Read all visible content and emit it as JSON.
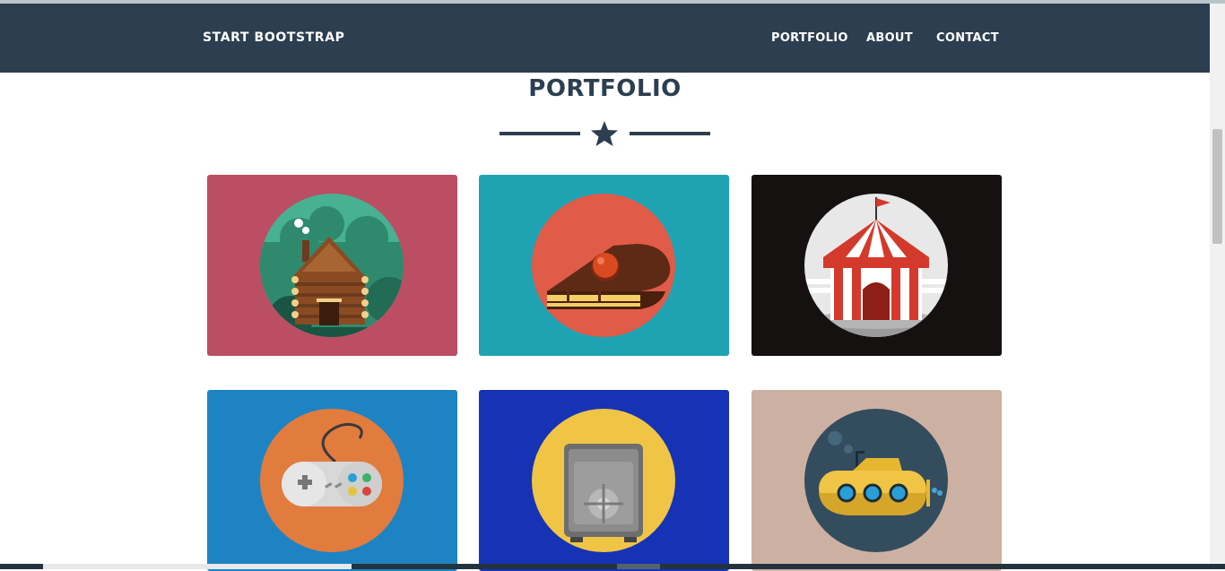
{
  "navbar": {
    "brand": "Start Bootstrap",
    "links": [
      "Portfolio",
      "About",
      "Contact"
    ]
  },
  "section": {
    "title": "Portfolio"
  },
  "portfolio_items": [
    {
      "icon": "cabin-icon",
      "background": "#bb4e63",
      "circle": "#47b192"
    },
    {
      "icon": "cake-icon",
      "background": "#1fa3b2",
      "circle": "#e05b48"
    },
    {
      "icon": "circus-tent-icon",
      "background": "#141110",
      "circle": "#e8e8e8"
    },
    {
      "icon": "game-controller-icon",
      "background": "#1e83c3",
      "circle": "#e27b3e"
    },
    {
      "icon": "safe-icon",
      "background": "#1633b6",
      "circle": "#f0c445"
    },
    {
      "icon": "submarine-icon",
      "background": "#ccb1a3",
      "circle": "#344d5e"
    }
  ],
  "colors": {
    "navbar": "#2c3e50",
    "accent": "#2c3e50"
  }
}
